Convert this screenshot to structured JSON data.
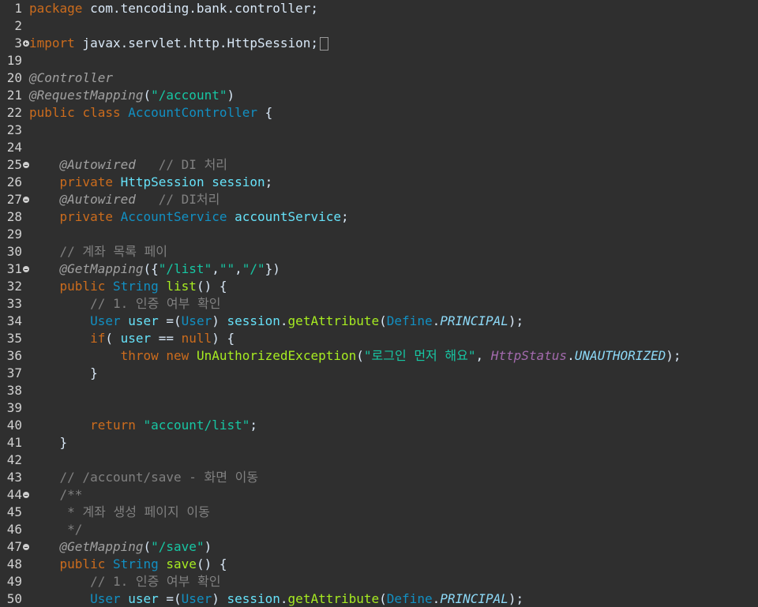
{
  "editor": {
    "lines": [
      {
        "n": "1",
        "fold": "",
        "t": [
          [
            "kw",
            "package"
          ],
          [
            "plain",
            " com.tencoding.bank.controller;"
          ]
        ]
      },
      {
        "n": "2",
        "fold": "",
        "t": []
      },
      {
        "n": "3",
        "fold": "expand",
        "t": [
          [
            "kw",
            "import"
          ],
          [
            "plain",
            " javax.servlet.http.HttpSession;"
          ]
        ],
        "collapsed": true
      },
      {
        "n": "19",
        "fold": "",
        "t": []
      },
      {
        "n": "20",
        "fold": "",
        "t": [
          [
            "ann",
            "@Controller"
          ]
        ]
      },
      {
        "n": "21",
        "fold": "",
        "t": [
          [
            "ann",
            "@RequestMapping"
          ],
          [
            "plain",
            "("
          ],
          [
            "str",
            "\"/account\""
          ],
          [
            "plain",
            ")"
          ]
        ]
      },
      {
        "n": "22",
        "fold": "",
        "t": [
          [
            "kw",
            "public"
          ],
          [
            "plain",
            " "
          ],
          [
            "kw",
            "class"
          ],
          [
            "plain",
            " "
          ],
          [
            "type",
            "AccountController"
          ],
          [
            "plain",
            " {"
          ]
        ]
      },
      {
        "n": "23",
        "fold": "",
        "t": []
      },
      {
        "n": "24",
        "fold": "",
        "t": []
      },
      {
        "n": "25",
        "fold": "fold",
        "t": [
          [
            "plain",
            "    "
          ],
          [
            "ann",
            "@Autowired"
          ],
          [
            "plain",
            "   "
          ],
          [
            "cmt",
            "// DI 처리"
          ]
        ]
      },
      {
        "n": "26",
        "fold": "",
        "t": [
          [
            "plain",
            "    "
          ],
          [
            "kw",
            "private"
          ],
          [
            "plain",
            " "
          ],
          [
            "field",
            "HttpSession"
          ],
          [
            "plain",
            " "
          ],
          [
            "field",
            "session"
          ],
          [
            "plain",
            ";"
          ]
        ]
      },
      {
        "n": "27",
        "fold": "fold",
        "t": [
          [
            "plain",
            "    "
          ],
          [
            "ann",
            "@Autowired"
          ],
          [
            "plain",
            "   "
          ],
          [
            "cmt",
            "// DI처리"
          ]
        ]
      },
      {
        "n": "28",
        "fold": "",
        "t": [
          [
            "plain",
            "    "
          ],
          [
            "kw",
            "private"
          ],
          [
            "plain",
            " "
          ],
          [
            "type",
            "AccountService"
          ],
          [
            "plain",
            " "
          ],
          [
            "field",
            "accountService"
          ],
          [
            "plain",
            ";"
          ]
        ]
      },
      {
        "n": "29",
        "fold": "",
        "t": []
      },
      {
        "n": "30",
        "fold": "",
        "t": [
          [
            "plain",
            "    "
          ],
          [
            "cmt",
            "// 계좌 목록 페이"
          ]
        ]
      },
      {
        "n": "31",
        "fold": "fold",
        "t": [
          [
            "plain",
            "    "
          ],
          [
            "ann",
            "@GetMapping"
          ],
          [
            "plain",
            "({"
          ],
          [
            "str",
            "\"/list\""
          ],
          [
            "plain",
            ","
          ],
          [
            "str",
            "\"\""
          ],
          [
            "plain",
            ","
          ],
          [
            "str",
            "\"/\""
          ],
          [
            "plain",
            "})"
          ]
        ]
      },
      {
        "n": "32",
        "fold": "",
        "t": [
          [
            "plain",
            "    "
          ],
          [
            "kw",
            "public"
          ],
          [
            "plain",
            " "
          ],
          [
            "type",
            "String"
          ],
          [
            "plain",
            " "
          ],
          [
            "method",
            "list"
          ],
          [
            "plain",
            "() {"
          ]
        ]
      },
      {
        "n": "33",
        "fold": "",
        "t": [
          [
            "plain",
            "        "
          ],
          [
            "cmt",
            "// 1. 인증 여부 확인"
          ]
        ]
      },
      {
        "n": "34",
        "fold": "",
        "t": [
          [
            "plain",
            "        "
          ],
          [
            "type",
            "User"
          ],
          [
            "plain",
            " "
          ],
          [
            "field",
            "user"
          ],
          [
            "plain",
            " =("
          ],
          [
            "type",
            "User"
          ],
          [
            "plain",
            ") "
          ],
          [
            "field",
            "session"
          ],
          [
            "plain",
            "."
          ],
          [
            "method",
            "getAttribute"
          ],
          [
            "plain",
            "("
          ],
          [
            "type",
            "Define"
          ],
          [
            "plain",
            "."
          ],
          [
            "const",
            "PRINCIPAL"
          ],
          [
            "plain",
            ");"
          ]
        ]
      },
      {
        "n": "35",
        "fold": "",
        "t": [
          [
            "plain",
            "        "
          ],
          [
            "kw",
            "if"
          ],
          [
            "plain",
            "( "
          ],
          [
            "field",
            "user"
          ],
          [
            "plain",
            " == "
          ],
          [
            "kw",
            "null"
          ],
          [
            "plain",
            ") {"
          ]
        ]
      },
      {
        "n": "36",
        "fold": "",
        "t": [
          [
            "plain",
            "            "
          ],
          [
            "kw",
            "throw"
          ],
          [
            "plain",
            " "
          ],
          [
            "kw",
            "new"
          ],
          [
            "plain",
            " "
          ],
          [
            "method",
            "UnAuthorizedException"
          ],
          [
            "plain",
            "("
          ],
          [
            "str",
            "\"로그인 먼저 해요\""
          ],
          [
            "plain",
            ", "
          ],
          [
            "sconst",
            "HttpStatus"
          ],
          [
            "plain",
            "."
          ],
          [
            "const",
            "UNAUTHORIZED"
          ],
          [
            "plain",
            ");"
          ]
        ]
      },
      {
        "n": "37",
        "fold": "",
        "t": [
          [
            "plain",
            "        }"
          ]
        ]
      },
      {
        "n": "38",
        "fold": "",
        "t": []
      },
      {
        "n": "39",
        "fold": "",
        "t": []
      },
      {
        "n": "40",
        "fold": "",
        "t": [
          [
            "plain",
            "        "
          ],
          [
            "kw",
            "return"
          ],
          [
            "plain",
            " "
          ],
          [
            "str",
            "\"account/list\""
          ],
          [
            "plain",
            ";"
          ]
        ]
      },
      {
        "n": "41",
        "fold": "",
        "t": [
          [
            "plain",
            "    }"
          ]
        ]
      },
      {
        "n": "42",
        "fold": "",
        "t": []
      },
      {
        "n": "43",
        "fold": "",
        "t": [
          [
            "plain",
            "    "
          ],
          [
            "cmt",
            "// /account/save - 화면 이동"
          ]
        ]
      },
      {
        "n": "44",
        "fold": "fold",
        "t": [
          [
            "plain",
            "    "
          ],
          [
            "cmt",
            "/**"
          ]
        ]
      },
      {
        "n": "45",
        "fold": "",
        "t": [
          [
            "plain",
            "     "
          ],
          [
            "cmt",
            "* 계좌 생성 페이지 이동"
          ]
        ]
      },
      {
        "n": "46",
        "fold": "",
        "t": [
          [
            "plain",
            "     "
          ],
          [
            "cmt",
            "*/"
          ]
        ]
      },
      {
        "n": "47",
        "fold": "fold",
        "t": [
          [
            "plain",
            "    "
          ],
          [
            "ann",
            "@GetMapping"
          ],
          [
            "plain",
            "("
          ],
          [
            "str",
            "\"/save\""
          ],
          [
            "plain",
            ")"
          ]
        ]
      },
      {
        "n": "48",
        "fold": "",
        "t": [
          [
            "plain",
            "    "
          ],
          [
            "kw",
            "public"
          ],
          [
            "plain",
            " "
          ],
          [
            "type",
            "String"
          ],
          [
            "plain",
            " "
          ],
          [
            "method",
            "save"
          ],
          [
            "plain",
            "() {"
          ]
        ]
      },
      {
        "n": "49",
        "fold": "",
        "t": [
          [
            "plain",
            "        "
          ],
          [
            "cmt",
            "// 1. 인증 여부 확인"
          ]
        ]
      },
      {
        "n": "50",
        "fold": "",
        "t": [
          [
            "plain",
            "        "
          ],
          [
            "type",
            "User"
          ],
          [
            "plain",
            " "
          ],
          [
            "field",
            "user"
          ],
          [
            "plain",
            " =("
          ],
          [
            "type",
            "User"
          ],
          [
            "plain",
            ") "
          ],
          [
            "field",
            "session"
          ],
          [
            "plain",
            "."
          ],
          [
            "method",
            "getAttribute"
          ],
          [
            "plain",
            "("
          ],
          [
            "type",
            "Define"
          ],
          [
            "plain",
            "."
          ],
          [
            "const",
            "PRINCIPAL"
          ],
          [
            "plain",
            ");"
          ]
        ]
      }
    ]
  }
}
